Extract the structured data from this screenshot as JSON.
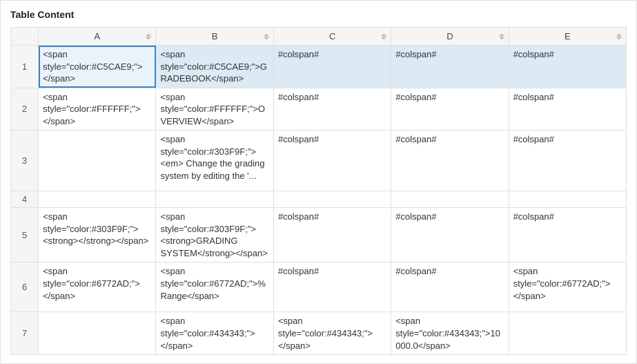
{
  "panel": {
    "title": "Table Content"
  },
  "grid": {
    "columns": [
      "A",
      "B",
      "C",
      "D",
      "E"
    ],
    "rows": [
      {
        "num": "1",
        "selected": true,
        "activeCol": 0,
        "cells": [
          "<span style=\"color:#C5CAE9;\"></span>",
          "<span style=\"color:#C5CAE9;\">GRADEBOOK</span>",
          "#colspan#",
          "#colspan#",
          "#colspan#"
        ]
      },
      {
        "num": "2",
        "cells": [
          "<span style=\"color:#FFFFFF;\"></span>",
          "<span style=\"color:#FFFFFF;\">OVERVIEW</span>",
          "#colspan#",
          "#colspan#",
          "#colspan#"
        ]
      },
      {
        "num": "3",
        "cells": [
          "",
          "<span style=\"color:#303F9F;\"><em>\nChange the grading system by editing the '...",
          "#colspan#",
          "#colspan#",
          "#colspan#"
        ]
      },
      {
        "num": "4",
        "cells": [
          "",
          "",
          "",
          "",
          ""
        ]
      },
      {
        "num": "5",
        "cells": [
          "<span style=\"color:#303F9F;\"><strong></strong></span>",
          "<span style=\"color:#303F9F;\"><strong>GRADING SYSTEM</strong></span>",
          "#colspan#",
          "#colspan#",
          "#colspan#"
        ]
      },
      {
        "num": "6",
        "cells": [
          "<span style=\"color:#6772AD;\"></span>",
          "<span style=\"color:#6772AD;\">% Range</span>",
          "#colspan#",
          "#colspan#",
          "<span style=\"color:#6772AD;\"></span>"
        ]
      },
      {
        "num": "7",
        "cells": [
          "",
          "<span style=\"color:#434343;\"></span>",
          "<span style=\"color:#434343;\"></span>",
          "<span style=\"color:#434343;\">10000.0</span>",
          ""
        ]
      }
    ]
  }
}
